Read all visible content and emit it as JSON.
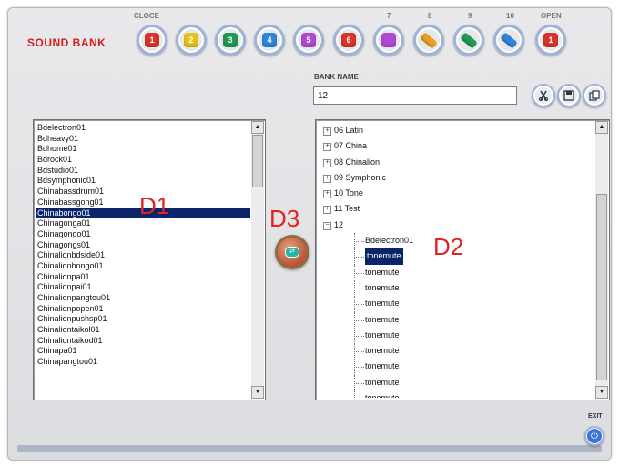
{
  "header": {
    "title": "SOUND BANK",
    "close_label": "CLOCE",
    "open_label": "OPEN",
    "num_labels": [
      "7",
      "8",
      "9",
      "10"
    ]
  },
  "bank_buttons": [
    {
      "glyph": "1",
      "color": "#d9342b",
      "icon": "bank-1-icon"
    },
    {
      "glyph": "2",
      "color": "#e9c21a",
      "icon": "bank-2-icon"
    },
    {
      "glyph": "3",
      "color": "#1f9a55",
      "icon": "bank-3-icon"
    },
    {
      "glyph": "4",
      "color": "#2f86d8",
      "icon": "bank-4-icon"
    },
    {
      "glyph": "5",
      "color": "#b04ad6",
      "icon": "bank-5-icon"
    },
    {
      "glyph": "6",
      "color": "#d9342b",
      "icon": "bank-6-icon"
    },
    {
      "glyph": "",
      "color": "#b04ad6",
      "icon": "bank-7-icon"
    },
    {
      "glyph": "",
      "color": "#e9a020",
      "icon": "bank-8-icon"
    },
    {
      "glyph": "",
      "color": "#1f9a55",
      "icon": "bank-9-icon"
    },
    {
      "glyph": "",
      "color": "#2f86d8",
      "icon": "bank-10-icon"
    },
    {
      "glyph": "1",
      "color": "#d9342b",
      "icon": "open-icon"
    }
  ],
  "bank_name": {
    "label": "BANK NAME",
    "value": "12"
  },
  "tool_icons": [
    "cut-icon",
    "save-icon",
    "copy-icon"
  ],
  "d1_list": {
    "items": [
      "Bdelectron01",
      "Bdheavy01",
      "Bdhome01",
      "Bdrock01",
      "Bdstudio01",
      "Bdsymphonic01",
      "Chinabassdrum01",
      "Chinabassgong01",
      "Chinabongo01",
      "Chinagonga01",
      "Chinagongo01",
      "Chinagongs01",
      "Chinalionbdside01",
      "Chinalionbongo01",
      "Chinalionpa01",
      "Chinalionpai01",
      "Chinalionpangtou01",
      "Chinalionpopen01",
      "Chinalionpushsp01",
      "Chinaliontaikol01",
      "Chinaliontaikod01",
      "Chinapa01",
      "Chinapangtou01"
    ],
    "selected_index": 8
  },
  "d2_tree": {
    "folders": [
      "06 Latin",
      "07 China",
      "08 Chinalion",
      "09 Symphonic",
      "10 Tone",
      "11 Test"
    ],
    "open_folder": "12",
    "children": [
      "Bdelectron01",
      "tonemute",
      "tonemute",
      "tonemute",
      "tonemute",
      "tonemute",
      "tonemute",
      "tonemute",
      "tonemute",
      "tonemute",
      "tonemute"
    ],
    "selected_child": 1
  },
  "annotations": {
    "d1": "D1",
    "d2": "D2",
    "d3": "D3"
  },
  "exit": {
    "label": "EXIT"
  },
  "colors": {
    "title_red": "#d51a1a",
    "selection": "#0a246a",
    "annotation_red": "#e32222"
  }
}
